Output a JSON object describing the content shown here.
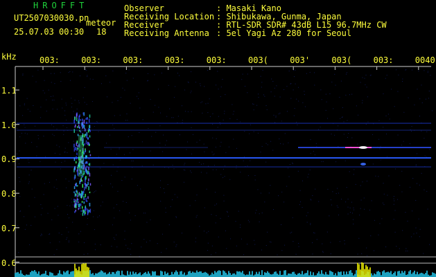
{
  "header": {
    "brand": "HROFFT",
    "filename": "UT2507030030.pn",
    "filename_suffix": "meteor",
    "datetime": "25.07.03 00:30",
    "count": "18",
    "fields": [
      {
        "label": "Observer",
        "value": ": Masaki Kano"
      },
      {
        "label": "Receiving Location",
        "value": ": Shibukawa, Gunma, Japan"
      },
      {
        "label": "Receiver",
        "value": ": RTL-SDR SDR# 43dB L15 96.7MHz CW"
      },
      {
        "label": "Receiving Antenna",
        "value": ": 5el Yagi Az 280 for Seoul"
      }
    ]
  },
  "axis": {
    "unit": "kHz",
    "y_ticks": [
      "1.1",
      "1.0",
      "0.9",
      "0.8",
      "0.7",
      "0.6"
    ],
    "x_ticks": [
      "003:",
      "003:",
      "003:",
      "003:",
      "003:",
      "003(",
      "003'",
      "003(",
      "003:",
      "0040"
    ]
  },
  "colors": {
    "text": "#ffff3c",
    "brand": "#1fd33b",
    "background": "#000000",
    "signal_line": "#2a5cff",
    "strong_signal": "#ff4fd8",
    "spectrum": "#27d7ff",
    "spectrum_peak": "#ffff00"
  }
}
